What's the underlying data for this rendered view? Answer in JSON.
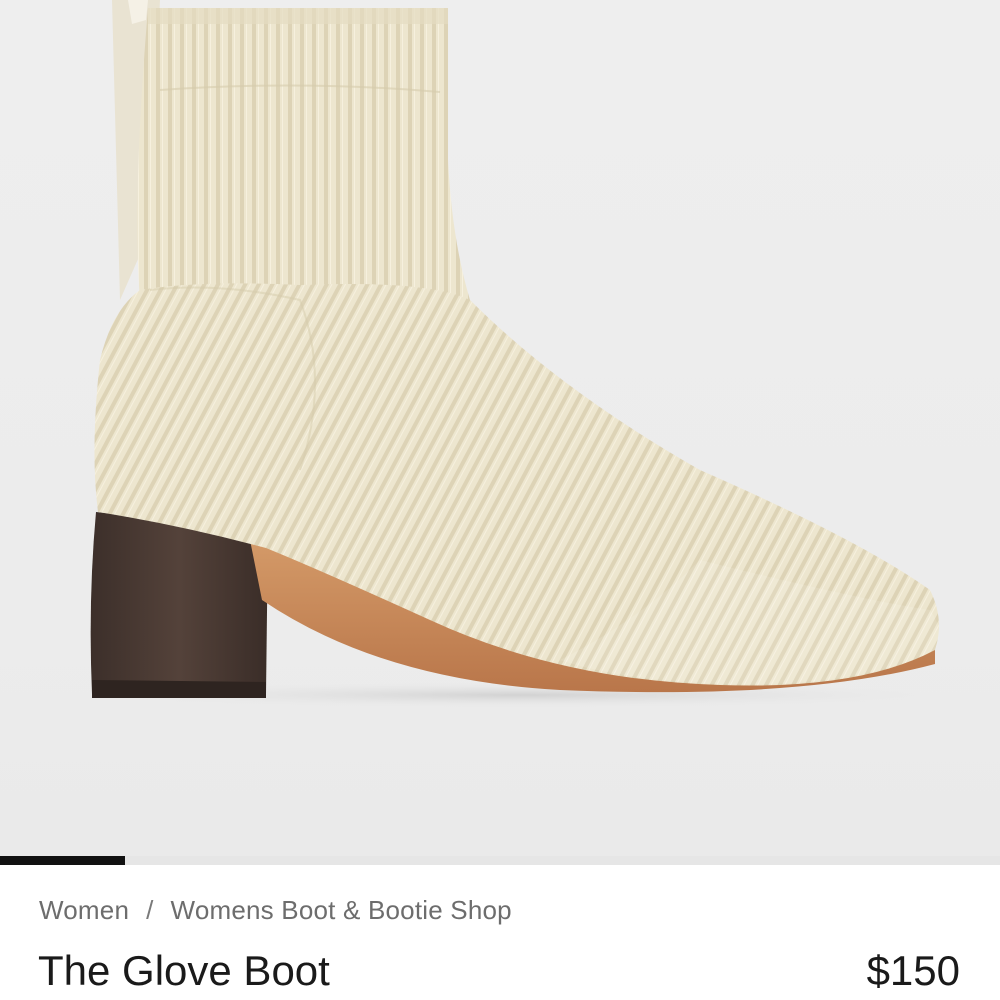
{
  "product_image": {
    "icon": "knit-ankle-boot-image",
    "background_color": "#ececec",
    "knit_color": "#ede6cf",
    "heel_color": "#4a3a33",
    "sole_color": "#c98a58"
  },
  "gallery": {
    "progress": 0.125
  },
  "breadcrumb": {
    "items": [
      "Women",
      "Womens Boot & Bootie Shop"
    ],
    "separator": "/"
  },
  "product": {
    "name": "The Glove Boot",
    "price": "$150"
  }
}
